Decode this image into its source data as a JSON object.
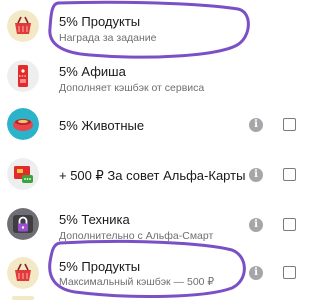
{
  "offers": [
    {
      "title": "5% Продукты",
      "subtitle": "Награда за задание",
      "icon": "basket-icon"
    },
    {
      "title": "5% Афиша",
      "subtitle": "Дополняет кэшбэк от сервиса",
      "icon": "ticket-icon"
    },
    {
      "title": "5% Животные",
      "subtitle": "",
      "icon": "pet-bowl-icon"
    },
    {
      "title": "+ 500 ₽ За совет Альфа-Карты",
      "subtitle": "",
      "icon": "card-message-icon"
    },
    {
      "title": "5% Техника",
      "subtitle": "Дополнительно с Альфа-Смарт",
      "icon": "lock-icon"
    },
    {
      "title": "5% Продукты",
      "subtitle": "Максимальный кэшбэк — 500 ₽",
      "icon": "basket-icon"
    }
  ],
  "info_glyph": "i",
  "colors": {
    "highlight": "#7b4fc6",
    "info": "#a6a6aa",
    "checkbox_border": "#7b7b80"
  }
}
